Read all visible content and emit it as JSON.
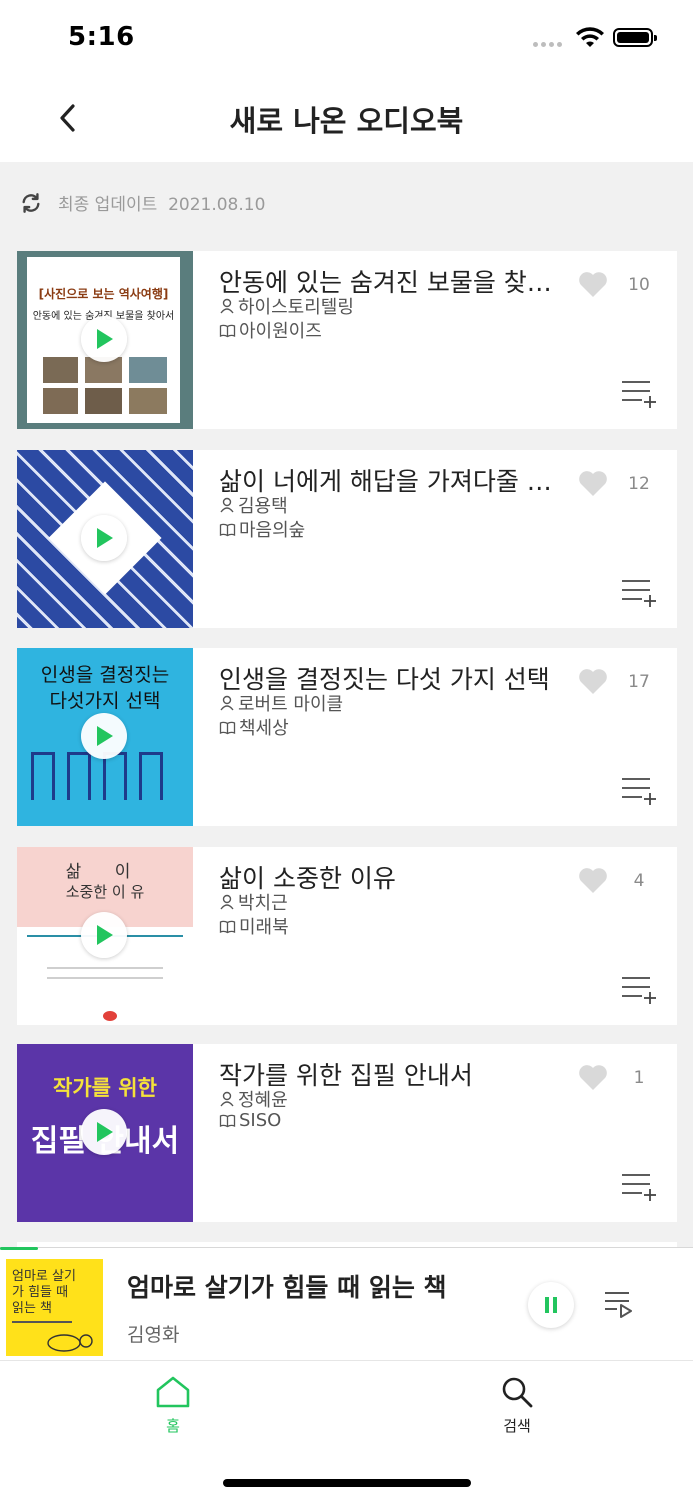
{
  "status_bar": {
    "time": "5:16"
  },
  "header": {
    "title": "새로 나온 오디오북"
  },
  "update": {
    "label": "최종 업데이트",
    "date": "2021.08.10"
  },
  "colors": {
    "accent": "#22c55e",
    "background": "#f1f1f1"
  },
  "books": [
    {
      "title": "안동에 있는 숨겨진 보물을 찾아서",
      "author": "하이스토리텔링",
      "publisher": "아이원이즈",
      "likes": "10",
      "cover": {
        "title": "[사진으로 보는 역사여행]",
        "subtitle": "안동에 있는 숨겨진 보물을 찾아서"
      }
    },
    {
      "title": "삶이 너에게 해답을 가져다줄 것이다",
      "author": "김용택",
      "publisher": "마음의숲",
      "likes": "12",
      "cover": {
        "title": "",
        "subtitle": ""
      }
    },
    {
      "title": "인생을 결정짓는 다섯 가지 선택",
      "author": "로버트 마이클",
      "publisher": "책세상",
      "likes": "17",
      "cover": {
        "title": "인생을 결정짓는",
        "subtitle": "다섯가지 선택"
      }
    },
    {
      "title": "삶이 소중한 이유",
      "author": "박치근",
      "publisher": "미래북",
      "likes": "4",
      "cover": {
        "title": "삶 이",
        "subtitle": "소중한 이 유"
      }
    },
    {
      "title": "작가를 위한 집필 안내서",
      "author": "정혜윤",
      "publisher": "SISO",
      "likes": "1",
      "cover": {
        "title": "작가를 위한",
        "subtitle": "집필 안내서"
      }
    }
  ],
  "now_playing": {
    "title": "엄마로 살기가 힘들 때 읽는 책",
    "author": "김영화",
    "cover_text": "엄마로 살기가 힘들 때 읽는 책",
    "progress": 0.055
  },
  "tabs": [
    {
      "label": "홈",
      "icon": "home-icon",
      "active": true
    },
    {
      "label": "검색",
      "icon": "search-icon",
      "active": false
    }
  ]
}
